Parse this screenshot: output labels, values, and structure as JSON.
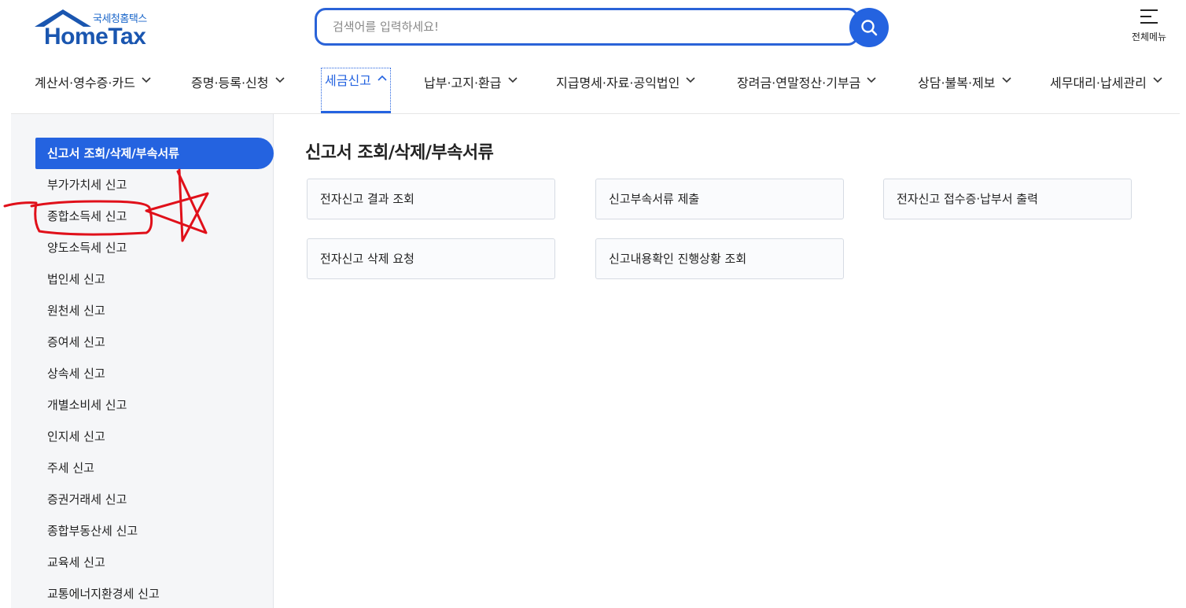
{
  "header": {
    "logo_sub": "국세청홈택스",
    "logo_main": "HomeTax",
    "search_placeholder": "검색어를 입력하세요!",
    "allmenu_label": "전체메뉴"
  },
  "gnb": {
    "items": [
      {
        "label": "계산서·영수증·카드",
        "active": false
      },
      {
        "label": "증명·등록·신청",
        "active": false
      },
      {
        "label": "세금신고",
        "active": true
      },
      {
        "label": "납부·고지·환급",
        "active": false
      },
      {
        "label": "지급명세·자료·공익법인",
        "active": false
      },
      {
        "label": "장려금·연말정산·기부금",
        "active": false
      },
      {
        "label": "상담·불복·제보",
        "active": false
      },
      {
        "label": "세무대리·납세관리",
        "active": false
      }
    ]
  },
  "sidebar": {
    "items": [
      {
        "label": "신고서 조회/삭제/부속서류",
        "active": true
      },
      {
        "label": "부가가치세 신고"
      },
      {
        "label": "종합소득세 신고"
      },
      {
        "label": "양도소득세 신고"
      },
      {
        "label": "법인세 신고"
      },
      {
        "label": "원천세 신고"
      },
      {
        "label": "증여세 신고"
      },
      {
        "label": "상속세 신고"
      },
      {
        "label": "개별소비세 신고"
      },
      {
        "label": "인지세 신고"
      },
      {
        "label": "주세 신고"
      },
      {
        "label": "증권거래세 신고"
      },
      {
        "label": "종합부동산세 신고"
      },
      {
        "label": "교육세 신고"
      },
      {
        "label": "교통에너지환경세 신고"
      }
    ]
  },
  "main": {
    "title": "신고서 조회/삭제/부속서류",
    "cards": [
      {
        "label": "전자신고 결과 조회"
      },
      {
        "label": "신고부속서류 제출"
      },
      {
        "label": "전자신고 접수증·납부서 출력"
      },
      {
        "label": "전자신고 삭제 요청"
      },
      {
        "label": "신고내용확인 진행상황 조회"
      }
    ]
  },
  "colors": {
    "accent": "#2463e0",
    "logo": "#1a56b0",
    "annotation": "#e0101a"
  }
}
